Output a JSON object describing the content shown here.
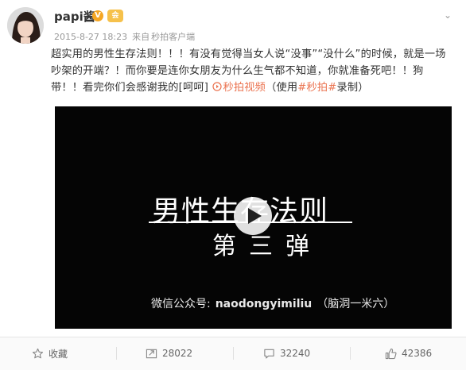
{
  "post": {
    "author": {
      "username": "papi酱",
      "verified_symbol": "V",
      "vip_label": "会"
    },
    "meta": {
      "timestamp": "2015-8-27 18:23",
      "source_prefix": "来自",
      "source": "秒拍客户端"
    },
    "content": {
      "segments": [
        {
          "text": "超实用的男性生存法则！！！有没有觉得当女人说“没事”“没什么”的时候，就是一场吵架的开端？！而你要是连你女朋友为什么生气都不知道，你就准备死吧！！狗带！！看完你们会感谢我的[呵呵] ",
          "type": "text"
        },
        {
          "text": "秒拍视频",
          "type": "video-link"
        },
        {
          "text": "（使用",
          "type": "text"
        },
        {
          "text": "#秒拍#",
          "type": "tag"
        },
        {
          "text": "录制）",
          "type": "text"
        }
      ]
    },
    "video": {
      "title": "男性生存法则",
      "subtitle": "第三弹",
      "footer_prefix": "微信公众号:",
      "footer_handle": "naodongyimiliu",
      "footer_suffix": "（脑洞一米六）"
    },
    "actions": {
      "favorite": "收藏",
      "repost": "28022",
      "comment": "32240",
      "like": "42386"
    }
  },
  "colors": {
    "link": "#eb7350",
    "meta": "#999999",
    "text": "#333333",
    "video_bg": "#050505"
  },
  "icons": [
    "menu-caret-icon",
    "play-icon",
    "star-icon",
    "repost-icon",
    "comment-icon",
    "like-icon"
  ]
}
